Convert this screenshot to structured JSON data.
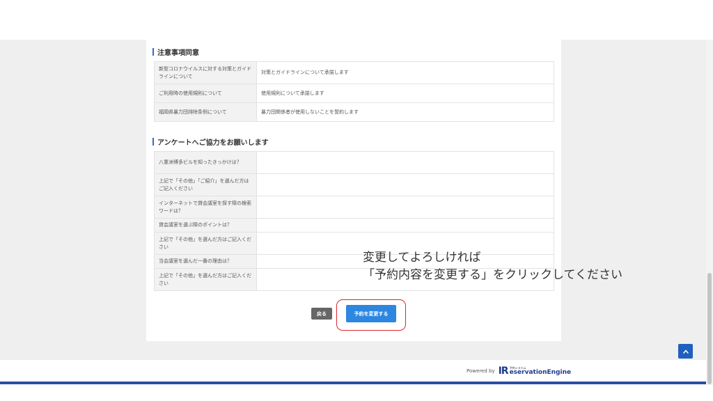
{
  "sections": {
    "consent": {
      "title": "注意事項同意",
      "rows": [
        {
          "label": "新型コロナウイルスに対する対策とガイドラインについて",
          "value": "対策とガイドラインについて承諾します"
        },
        {
          "label": "ご利用時の使用規則について",
          "value": "使用規則について承諾します"
        },
        {
          "label": "福岡県暴力団排除条例について",
          "value": "暴力団関係者が使用しないことを誓約します"
        }
      ]
    },
    "survey": {
      "title": "アンケートへご協力をお願いします",
      "rows": [
        {
          "label": "八重洲博多ビルを知ったきっかけは？",
          "value": ""
        },
        {
          "label": "上記で「その他」「ご紹介」を選んだ方はご記入ください",
          "value": ""
        },
        {
          "label": "インターネットで貸会議室を探す際の検索ワードは？",
          "value": ""
        },
        {
          "label": "貸会議室を選ぶ際のポイントは？",
          "value": ""
        },
        {
          "label": "上記で「その他」を選んだ方はご記入ください",
          "value": ""
        },
        {
          "label": "当会議室を選んだ一番の理由は？",
          "value": ""
        },
        {
          "label": "上記で「その他」を選んだ方はご記入ください",
          "value": ""
        }
      ]
    }
  },
  "buttons": {
    "back": "戻る",
    "change": "予約を変更する"
  },
  "annotation": {
    "line1": "変更してよろしければ",
    "line2": "「予約内容を変更する」をクリックしてください"
  },
  "footer": {
    "powered_by": "Powered by",
    "logo_small": "予約システム",
    "logo_main": "eservationEngine",
    "logo_mark": "IR"
  },
  "icons": {
    "scroll_top": "chevron-up-icon"
  },
  "colors": {
    "accent": "#2d86e0",
    "back_button": "#666666",
    "highlight": "#d9262c",
    "brand": "#1e3c8f"
  }
}
